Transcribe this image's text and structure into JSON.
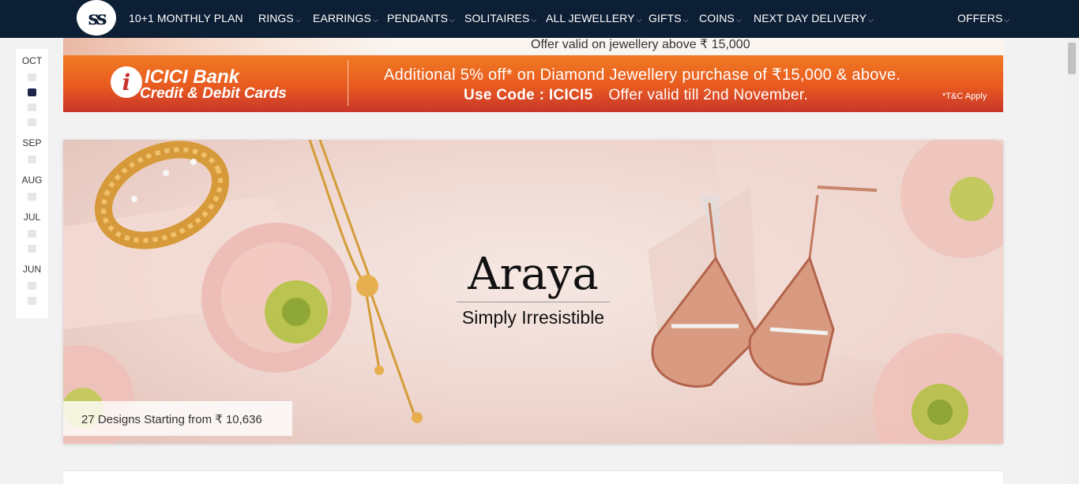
{
  "logo": {
    "text": "ꜱ",
    "icon": "brand-logo-icon"
  },
  "nav": {
    "items": [
      {
        "label": "10+1 MONTHLY PLAN",
        "dropdown": false
      },
      {
        "label": "RINGS",
        "dropdown": true
      },
      {
        "label": "EARRINGS",
        "dropdown": true
      },
      {
        "label": "PENDANTS",
        "dropdown": true
      },
      {
        "label": "SOLITAIRES",
        "dropdown": true
      },
      {
        "label": "ALL JEWELLERY",
        "dropdown": true
      },
      {
        "label": "GIFTS",
        "dropdown": true
      },
      {
        "label": "COINS",
        "dropdown": true
      },
      {
        "label": "NEXT DAY DELIVERY",
        "dropdown": true
      }
    ],
    "offers": "OFFERS",
    "chevron": "⌵"
  },
  "promo": {
    "top_text": "Offer valid on jewellery above ₹ 15,000",
    "bank_logo_letter": "i",
    "bank_name": "ICICI Bank",
    "bank_sub": "Credit & Debit Cards",
    "line1": "Additional 5% off* on Diamond Jewellery purchase of  ₹15,000 & above.",
    "code": "Use Code : ICICI5",
    "validity": "Offer valid till 2nd November.",
    "tnc": "*T&C Apply"
  },
  "timeline": {
    "months": [
      "OCT",
      "SEP",
      "AUG",
      "JUL",
      "JUN"
    ],
    "active_dot": 1
  },
  "hero": {
    "title": "Araya",
    "subtitle": "Simply Irresistible",
    "caption": "27 Designs Starting from ₹ 10,636"
  },
  "colors": {
    "nav_bg": "#0d1f35",
    "promo_orange": "#f07a22",
    "promo_red": "#c9352a",
    "timeline_active": "#1e2648",
    "hero_bg": "#eed6cf"
  }
}
